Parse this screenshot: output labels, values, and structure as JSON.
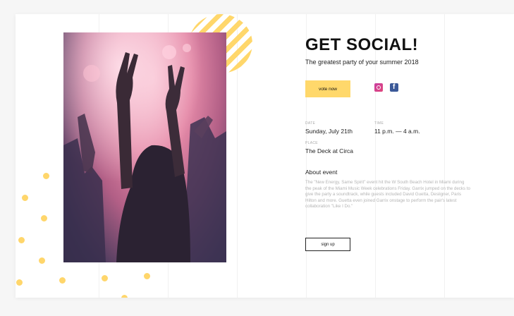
{
  "event": {
    "title": "GET SOCIAL!",
    "subtitle": "The greatest party of your summer 2018",
    "vote_label": "vote now",
    "signup_label": "sign up"
  },
  "social": [
    "instagram-icon",
    "facebook-icon"
  ],
  "details": {
    "date_label": "DATE",
    "date_value": "Sunday, July 21th",
    "time_label": "TIME",
    "time_value": "11 p.m. — 4 a.m.",
    "place_label": "PLACE",
    "place_value": "The Deck at Circa"
  },
  "about": {
    "heading": "About event",
    "text": "The \"New Energy, Same Spirit\" event hit the W South Beach Hotel in Miami during the peak of the Miami Music Week celebrations Friday. Garrix jumped on the decks to give the party a soundtrack, while guests included David Guetta, Desiigner, Paris Hilton and more. Guetta even joined Garrix onstage to perform the pair's latest collaboration \"Like I Do.\""
  },
  "colors": {
    "accent": "#ffd86b",
    "text": "#111111",
    "muted": "#b5b5b5"
  }
}
